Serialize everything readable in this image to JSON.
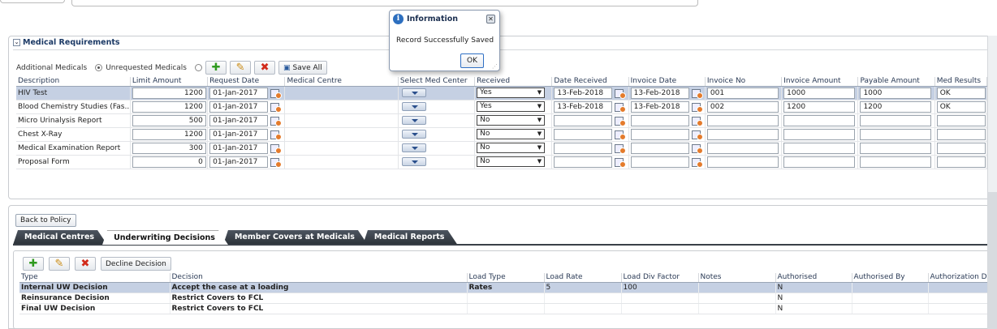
{
  "dialog": {
    "title": "Information",
    "message": "Record Successfully Saved",
    "ok_label": "OK"
  },
  "section": {
    "title": "Medical Requirements"
  },
  "toolbar": {
    "additional_label": "Additional Medicals",
    "unrequested_label": "Unrequested Medicals",
    "save_all_label": "Save All"
  },
  "medical_table": {
    "columns": [
      "Description",
      "Limit Amount",
      "Request Date",
      "Medical Centre",
      "Select Med Center",
      "Received",
      "Date Received",
      "Invoice Date",
      "Invoice No",
      "Invoice Amount",
      "Payable Amount",
      "Med Results"
    ],
    "rows": [
      {
        "description": "HIV Test",
        "limit": "1200",
        "request_date": "01-Jan-2017",
        "received": "Yes",
        "date_received": "13-Feb-2018",
        "invoice_date": "13-Feb-2018",
        "invoice_no": "001",
        "invoice_amount": "1000",
        "payable": "1000",
        "result": "OK"
      },
      {
        "description": "Blood Chemistry Studies (Fas...",
        "limit": "1200",
        "request_date": "01-Jan-2017",
        "received": "Yes",
        "date_received": "13-Feb-2018",
        "invoice_date": "13-Feb-2018",
        "invoice_no": "002",
        "invoice_amount": "1200",
        "payable": "1200",
        "result": "OK"
      },
      {
        "description": "Micro Urinalysis Report",
        "limit": "500",
        "request_date": "01-Jan-2017",
        "received": "No",
        "date_received": "",
        "invoice_date": "",
        "invoice_no": "",
        "invoice_amount": "",
        "payable": "",
        "result": ""
      },
      {
        "description": "Chest X-Ray",
        "limit": "1200",
        "request_date": "01-Jan-2017",
        "received": "No",
        "date_received": "",
        "invoice_date": "",
        "invoice_no": "",
        "invoice_amount": "",
        "payable": "",
        "result": ""
      },
      {
        "description": "Medical Examination Report",
        "limit": "300",
        "request_date": "01-Jan-2017",
        "received": "No",
        "date_received": "",
        "invoice_date": "",
        "invoice_no": "",
        "invoice_amount": "",
        "payable": "",
        "result": ""
      },
      {
        "description": "Proposal Form",
        "limit": "0",
        "request_date": "01-Jan-2017",
        "received": "No",
        "date_received": "",
        "invoice_date": "",
        "invoice_no": "",
        "invoice_amount": "",
        "payable": "",
        "result": ""
      }
    ]
  },
  "back_label": "Back to Policy",
  "tabs": [
    "Medical Centres",
    "Underwriting Decisions",
    "Member Covers at Medicals",
    "Medical Reports"
  ],
  "decision_label": "Decline Decision",
  "uw_table": {
    "columns": [
      "Type",
      "Decision",
      "Load Type",
      "Load Rate",
      "Load Div Factor",
      "Notes",
      "Authorised",
      "Authorised By",
      "Authorization Da"
    ],
    "rows": [
      {
        "type": "Internal UW Decision",
        "decision": "Accept the case at a loading",
        "load_type": "Rates",
        "load_rate": "5",
        "div": "100",
        "notes": "",
        "authorised": "N",
        "by": "",
        "date": ""
      },
      {
        "type": "Reinsurance Decision",
        "decision": "Restrict Covers to FCL",
        "load_type": "",
        "load_rate": "",
        "div": "",
        "notes": "",
        "authorised": "N",
        "by": "",
        "date": ""
      },
      {
        "type": "Final UW Decision",
        "decision": "Restrict Covers to FCL",
        "load_type": "",
        "load_rate": "",
        "div": "",
        "notes": "",
        "authorised": "N",
        "by": "",
        "date": ""
      }
    ]
  }
}
